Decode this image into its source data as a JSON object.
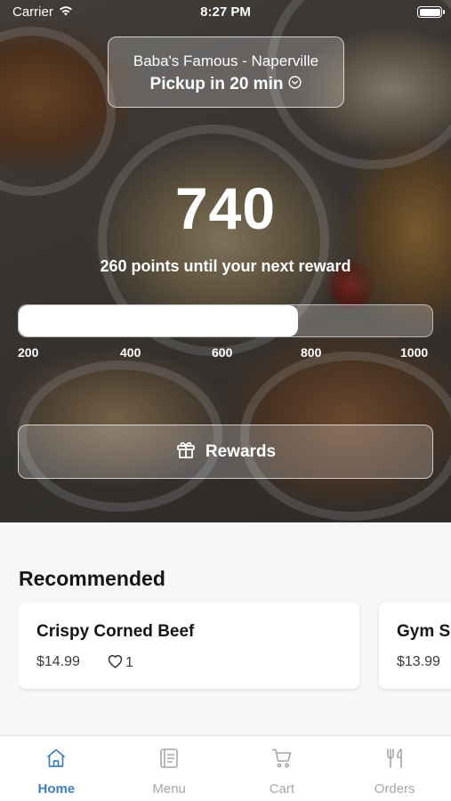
{
  "status_bar": {
    "carrier": "Carrier",
    "time": "8:27 PM"
  },
  "location": {
    "store_name": "Baba's Famous - Naperville",
    "pickup_text": "Pickup in 20 min"
  },
  "rewards": {
    "points": "740",
    "until_next": "260 points until your next reward",
    "progress": {
      "min": 200,
      "max": 1000,
      "value": 740
    },
    "ticks": [
      "200",
      "400",
      "600",
      "800",
      "1000"
    ],
    "button_label": "Rewards"
  },
  "recommended": {
    "title": "Recommended",
    "items": [
      {
        "name": "Crispy Corned Beef",
        "price": "$14.99",
        "likes": "1"
      },
      {
        "name": "Gym Special",
        "price": "$13.99",
        "likes": ""
      }
    ]
  },
  "tab_bar": {
    "tabs": [
      {
        "label": "Home",
        "icon": "home-icon",
        "active": true
      },
      {
        "label": "Menu",
        "icon": "menu-icon",
        "active": false
      },
      {
        "label": "Cart",
        "icon": "cart-icon",
        "active": false
      },
      {
        "label": "Orders",
        "icon": "fork-knife-icon",
        "active": false
      }
    ]
  },
  "colors": {
    "accent": "#3d7fbd",
    "inactive": "#a7a7a9"
  }
}
